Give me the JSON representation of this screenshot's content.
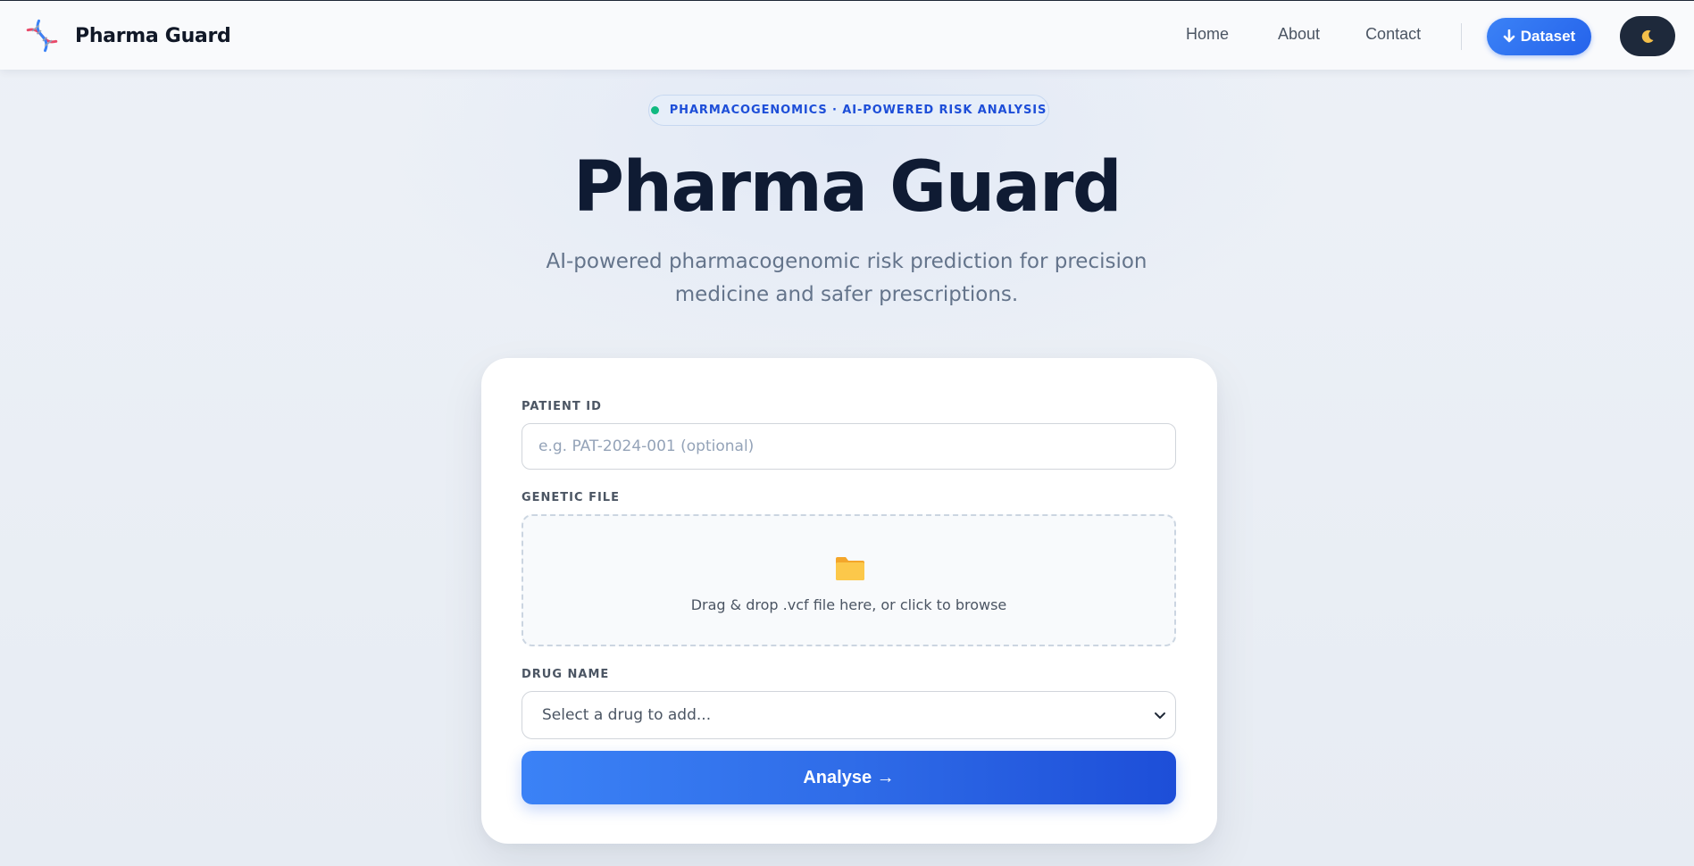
{
  "nav": {
    "brand": "Pharma Guard",
    "links": [
      "Home",
      "About",
      "Contact"
    ],
    "dataset_label": "Dataset",
    "theme_icon": "moon-icon"
  },
  "hero": {
    "badge": "PHARMACOGENOMICS · AI-POWERED RISK ANALYSIS",
    "title": "Pharma Guard",
    "subtitle": "AI-powered pharmacogenomic risk prediction for precision medicine and safer prescriptions."
  },
  "form": {
    "patient_label": "PATIENT ID",
    "patient_placeholder": "e.g. PAT-2024-001 (optional)",
    "genetic_label": "GENETIC FILE",
    "dropzone_text": "Drag & drop .vcf file here, or click to browse",
    "drug_label": "DRUG NAME",
    "drug_selected": "Select a drug to add...",
    "submit_label": "Analyse →"
  },
  "colors": {
    "accent": "#2563eb",
    "badge_dot": "#10b981",
    "title": "#0f1b33"
  }
}
